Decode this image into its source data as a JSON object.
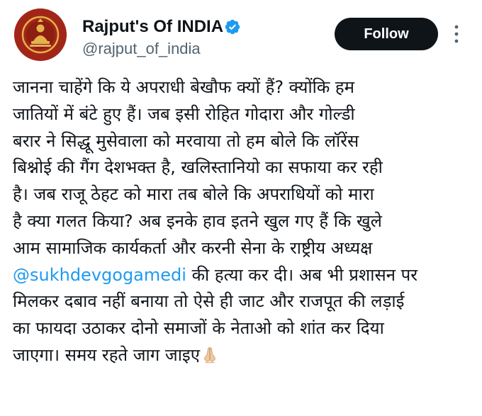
{
  "account": {
    "display_name": "Rajput's Of INDIA",
    "handle": "@rajput_of_india",
    "verified": true,
    "avatar_icon": "rajput-emblem-icon"
  },
  "actions": {
    "follow_label": "Follow",
    "more_icon": "more-vertical-icon"
  },
  "tweet": {
    "lines": [
      "जानना चाहेंगे कि ये अपराधी बेखौफ क्यों हैं? क्योंकि हम",
      "जातियों में बंटे हुए हैं। जब इसी रोहित गोदारा और गोल्डी",
      "बरार ने सिद्धू मुसेवाला को मरवाया तो हम बोले कि लॉरेंस",
      "बिश्नोई की गैंग देशभक्त है, खलिस्तानियो का सफाया कर रही",
      "है। जब राजू ठेहट को मारा तब बोले कि अपराधियों को मारा",
      "है क्या गलत किया? अब इनके हाव इतने खुल गए हैं कि खुले",
      "आम सामाजिक कार्यकर्ता और करनी सेना के राष्ट्रीय अध्यक्ष"
    ],
    "mention": "@sukhdevgogamedi",
    "mention_line_rest": " की हत्या कर दी। अब भी प्रशासन पर",
    "lines_after": [
      "मिलकर दबाव नहीं बनाया तो ऐसे ही जाट और राजपूत की लड़ाई",
      "का फायदा उठाकर दोनो समाजों के नेताओ को शांत कर दिया"
    ],
    "last_line": "जाएगा। समय रहते जाग जाइए",
    "emoji_icon": "folded-hands-icon"
  },
  "colors": {
    "text": "#0f1419",
    "secondary": "#536471",
    "link": "#1d9bf0",
    "verified": "#1d9bf0",
    "button_bg": "#0f1419"
  }
}
